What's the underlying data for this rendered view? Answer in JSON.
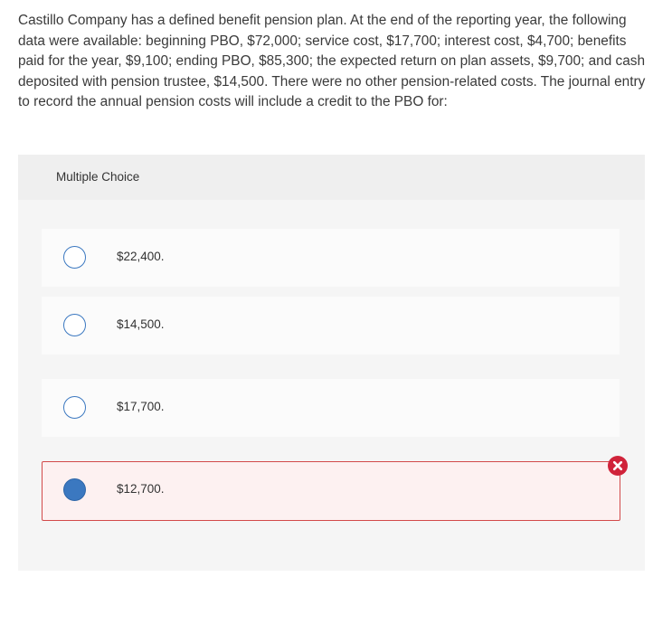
{
  "question": {
    "text": "Castillo Company has a defined benefit pension plan. At the end of the reporting year, the following data were available: beginning PBO, $72,000; service cost, $17,700; interest cost, $4,700; benefits paid for the year, $9,100; ending PBO, $85,300; the expected return on plan assets, $9,700; and cash deposited with pension trustee, $14,500. There were no other pension-related costs. The journal entry to record the annual pension costs will include a credit to the PBO for:"
  },
  "multiple_choice": {
    "title": "Multiple Choice",
    "options": [
      {
        "label": "$22,400.",
        "selected": false,
        "status": "none"
      },
      {
        "label": "$14,500.",
        "selected": false,
        "status": "none"
      },
      {
        "label": "$17,700.",
        "selected": false,
        "status": "none"
      },
      {
        "label": "$12,700.",
        "selected": true,
        "status": "incorrect"
      }
    ]
  },
  "colors": {
    "accent": "#3b78c0",
    "incorrect_border": "#d24a4a",
    "incorrect_fill": "#fdf1f1",
    "incorrect_icon": "#d0233a",
    "panel_bg": "#f5f5f5"
  },
  "icons": {
    "incorrect_marker": "x-circle-icon"
  }
}
